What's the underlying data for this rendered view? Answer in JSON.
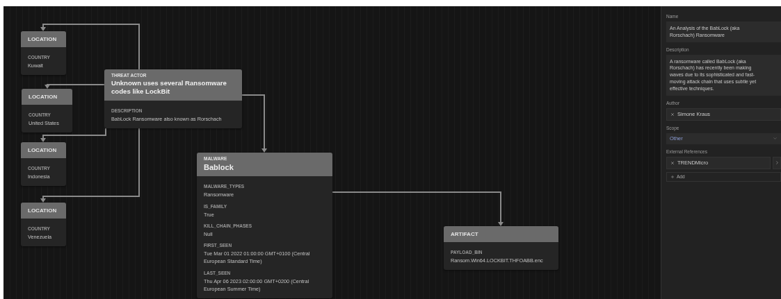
{
  "nodes": [
    {
      "kind": "location",
      "type_label": "LOCATION",
      "fields": [
        {
          "label": "COUNTRY",
          "value": "Kuwait"
        }
      ]
    },
    {
      "kind": "location",
      "type_label": "LOCATION",
      "fields": [
        {
          "label": "COUNTRY",
          "value": "United States"
        }
      ]
    },
    {
      "kind": "location",
      "type_label": "LOCATION",
      "fields": [
        {
          "label": "COUNTRY",
          "value": "Indonesia"
        }
      ]
    },
    {
      "kind": "location",
      "type_label": "LOCATION",
      "fields": [
        {
          "label": "COUNTRY",
          "value": "Venezuela"
        }
      ]
    },
    {
      "kind": "threat_actor",
      "type_label": "THREAT ACTOR",
      "title": "Unknown uses several Ransomware codes like LockBit",
      "fields": [
        {
          "label": "DESCRIPTION",
          "value": "BabLock Ransomware also known as Rorschach"
        }
      ]
    },
    {
      "kind": "malware",
      "type_label": "MALWARE",
      "title": "Bablock",
      "fields": [
        {
          "label": "MALWARE_TYPES",
          "value": "Ransomware"
        },
        {
          "label": "IS_FAMILY",
          "value": "True"
        },
        {
          "label": "KILL_CHAIN_PHASES",
          "value": "Null"
        },
        {
          "label": "FIRST_SEEN",
          "value": "Tue Mar 01 2022 01:00:00 GMT+0100 (Central European Standard Time)"
        },
        {
          "label": "LAST_SEEN",
          "value": "Thu Apr 06 2023 02:00:00 GMT+0200 (Central European Summer Time)"
        }
      ]
    },
    {
      "kind": "artifact",
      "type_label": "ARTIFACT",
      "fields": [
        {
          "label": "PAYLOAD_BIN",
          "value": "Ransom.Win64.LOCKBIT.THFOABB.enc"
        }
      ]
    }
  ],
  "panel": {
    "name": {
      "label": "Name",
      "value": "An Analysis of the BabLock (aka Rorschach) Ransomware"
    },
    "description": {
      "label": "Description",
      "value": "A ransomware called BabLock (aka Rorschach) has recently been making waves due to its sophisticated and fast-moving attack chain that uses subtle yet effective techniques."
    },
    "author": {
      "label": "Author",
      "value": "Simone Kraus"
    },
    "scope": {
      "label": "Scope",
      "value": "Other"
    },
    "external_references": {
      "label": "External References",
      "items": [
        "TRENDMicro"
      ],
      "add_button": "Add"
    }
  }
}
